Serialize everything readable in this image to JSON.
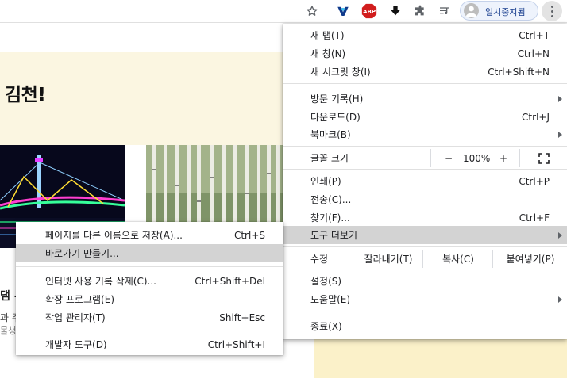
{
  "toolbar": {
    "icons": [
      "star-icon",
      "vpn-icon",
      "adblock-plus-icon",
      "download-icon",
      "extensions-icon",
      "media-control-icon"
    ],
    "adblock_label": "ABP",
    "profile_label": "일시중지됨",
    "colors": {
      "adblock": "#d11d1d",
      "profile_bg": "#eef3fc",
      "accent": "#1a3f8f"
    }
  },
  "page": {
    "banner_title": "김천!",
    "left_text_1": "댐 -",
    "left_text_2": "과 주변",
    "left_text_3": "물생태",
    "colors": {
      "banner_bg": "#fbf6e1",
      "footer_bg": "#fbf1c9"
    }
  },
  "main_menu": {
    "new_tab": {
      "label": "새 탭(T)",
      "shortcut": "Ctrl+T"
    },
    "new_window": {
      "label": "새 창(N)",
      "shortcut": "Ctrl+N"
    },
    "incognito": {
      "label": "새 시크릿 창(I)",
      "shortcut": "Ctrl+Shift+N"
    },
    "history": {
      "label": "방문 기록(H)"
    },
    "downloads": {
      "label": "다운로드(D)",
      "shortcut": "Ctrl+J"
    },
    "bookmarks": {
      "label": "북마크(B)"
    },
    "zoom": {
      "label": "글꼴 크기",
      "minus": "−",
      "value": "100%",
      "plus": "+"
    },
    "print": {
      "label": "인쇄(P)",
      "shortcut": "Ctrl+P"
    },
    "cast": {
      "label": "전송(C)..."
    },
    "find": {
      "label": "찾기(F)...",
      "shortcut": "Ctrl+F"
    },
    "more_tools": {
      "label": "도구 더보기"
    },
    "edit": {
      "label": "수정",
      "cut": "잘라내기(T)",
      "copy": "복사(C)",
      "paste": "붙여넣기(P)"
    },
    "settings": {
      "label": "설정(S)"
    },
    "help": {
      "label": "도움말(E)"
    },
    "exit": {
      "label": "종료(X)"
    }
  },
  "sub_menu": {
    "save_page": {
      "label": "페이지를 다른 이름으로 저장(A)...",
      "shortcut": "Ctrl+S"
    },
    "create_shortcut": {
      "label": "바로가기 만들기..."
    },
    "clear_data": {
      "label": "인터넷 사용 기록 삭제(C)...",
      "shortcut": "Ctrl+Shift+Del"
    },
    "extensions": {
      "label": "확장 프로그램(E)"
    },
    "task_manager": {
      "label": "작업 관리자(T)",
      "shortcut": "Shift+Esc"
    },
    "dev_tools": {
      "label": "개발자 도구(D)",
      "shortcut": "Ctrl+Shift+I"
    }
  }
}
